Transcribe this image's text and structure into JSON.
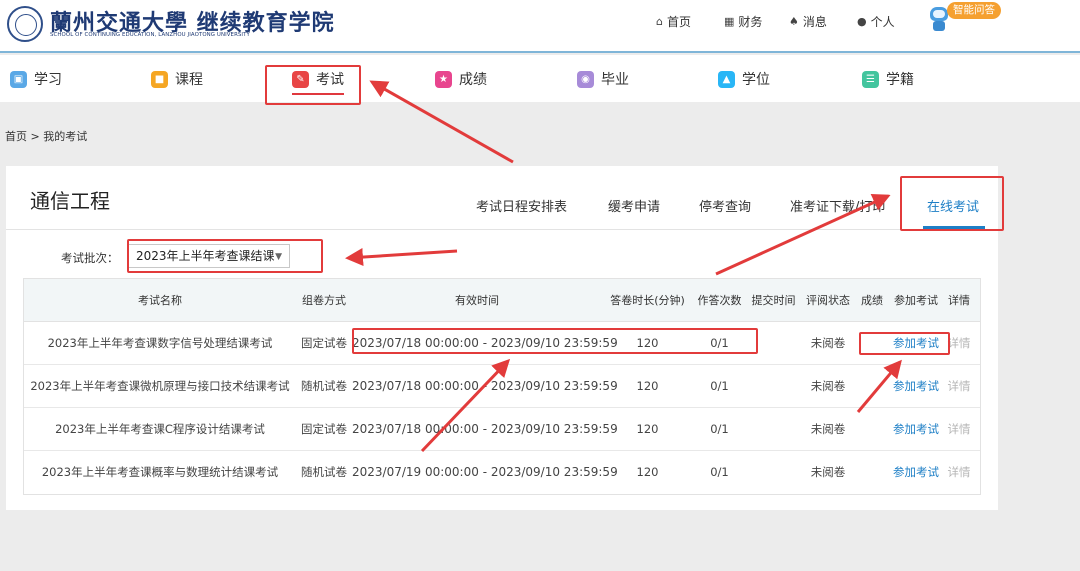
{
  "header": {
    "logo_cn": "蘭州交通大學 继续教育学院",
    "logo_en": "SCHOOL OF CONTINUING EDUCATION, LANZHOU JIAOTONG UNIVERSITY",
    "nav": [
      {
        "icon": "home-icon",
        "label": "首页"
      },
      {
        "icon": "database-icon",
        "label": "财务"
      },
      {
        "icon": "bell-icon",
        "label": "消息"
      },
      {
        "icon": "user-icon",
        "label": "个人"
      }
    ],
    "assistant_label": "智能问答"
  },
  "main_nav": {
    "items": [
      {
        "icon": "study-icon",
        "label": "学习",
        "color": "#5aa8e6"
      },
      {
        "icon": "course-icon",
        "label": "课程",
        "color": "#f5a623"
      },
      {
        "icon": "exam-icon",
        "label": "考试",
        "color": "#e84545",
        "active": true
      },
      {
        "icon": "score-icon",
        "label": "成绩",
        "color": "#e8458e"
      },
      {
        "icon": "graduation-icon",
        "label": "毕业",
        "color": "#a78bd8"
      },
      {
        "icon": "degree-icon",
        "label": "学位",
        "color": "#29b6f6"
      },
      {
        "icon": "roster-icon",
        "label": "学籍",
        "color": "#43c59e"
      }
    ]
  },
  "breadcrumb": "首页 > 我的考试",
  "panel": {
    "title": "通信工程",
    "tabs": [
      "考试日程安排表",
      "缓考申请",
      "停考查询",
      "准考证下载/打印",
      "在线考试"
    ],
    "active_tab": "在线考试",
    "batch_label": "考试批次：",
    "batch_value": "2023年上半年考查课结课"
  },
  "table": {
    "headers": [
      "考试名称",
      "组卷方式",
      "有效时间",
      "答卷时长(分钟)",
      "作答次数",
      "提交时间",
      "评阅状态",
      "成绩",
      "参加考试",
      "详情"
    ],
    "rows": [
      {
        "name": "2023年上半年考查课数字信号处理结课考试",
        "method": "固定试卷",
        "time": "2023/07/18 00:00:00 - 2023/09/10 23:59:59",
        "duration": "120",
        "attempts": "0/1",
        "submit": "",
        "status": "未阅卷",
        "score": "",
        "join": "参加考试",
        "detail": "详情"
      },
      {
        "name": "2023年上半年考查课微机原理与接口技术结课考试",
        "method": "随机试卷",
        "time": "2023/07/18 00:00:00 - 2023/09/10 23:59:59",
        "duration": "120",
        "attempts": "0/1",
        "submit": "",
        "status": "未阅卷",
        "score": "",
        "join": "参加考试",
        "detail": "详情"
      },
      {
        "name": "2023年上半年考查课C程序设计结课考试",
        "method": "固定试卷",
        "time": "2023/07/18 00:00:00 - 2023/09/10 23:59:59",
        "duration": "120",
        "attempts": "0/1",
        "submit": "",
        "status": "未阅卷",
        "score": "",
        "join": "参加考试",
        "detail": "详情"
      },
      {
        "name": "2023年上半年考查课概率与数理统计结课考试",
        "method": "随机试卷",
        "time": "2023/07/19 00:00:00 - 2023/09/10 23:59:59",
        "duration": "120",
        "attempts": "0/1",
        "submit": "",
        "status": "未阅卷",
        "score": "",
        "join": "参加考试",
        "detail": "详情"
      }
    ]
  },
  "colors": {
    "accent": "#1e7fc6",
    "annotation": "#e23b3b",
    "assistant_badge": "#f5a030"
  }
}
